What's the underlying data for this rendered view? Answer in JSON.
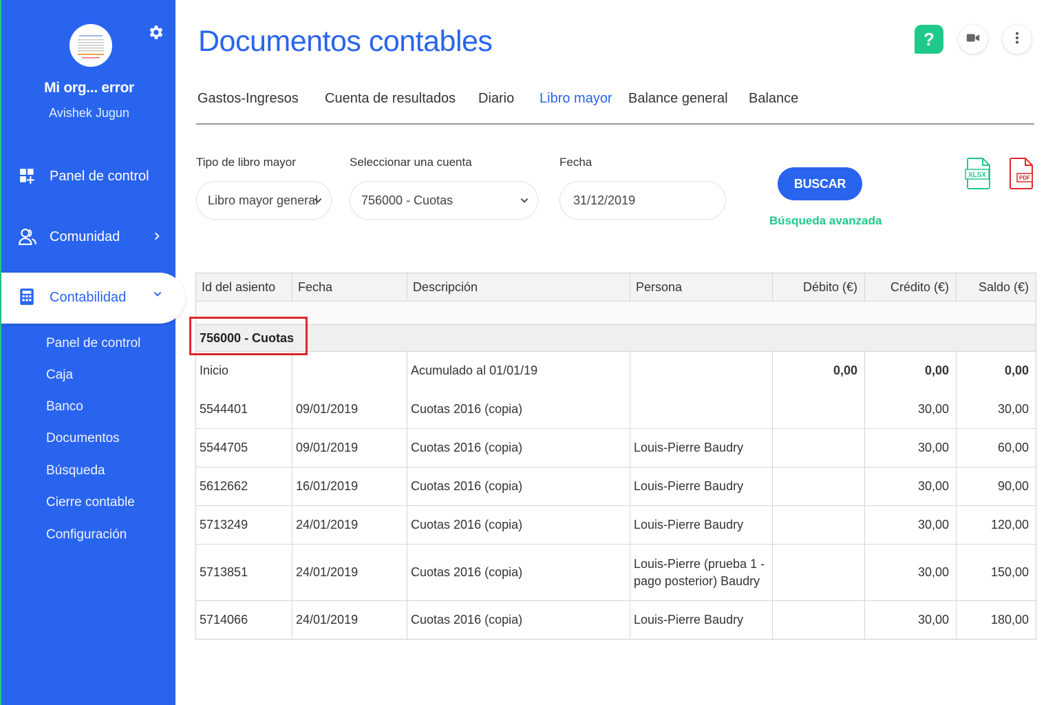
{
  "sidebar": {
    "org_name": "Mi org... error",
    "user_name": "Avishek Jugun",
    "nav": [
      {
        "label": "Panel de control",
        "icon": "dashboard-icon"
      },
      {
        "label": "Comunidad",
        "icon": "community-icon"
      }
    ],
    "active": {
      "label": "Contabilidad",
      "icon": "calculator-icon"
    },
    "sub_items": [
      "Panel de control",
      "Caja",
      "Banco",
      "Documentos",
      "Búsqueda",
      "Cierre contable",
      "Configuración"
    ]
  },
  "header": {
    "title": "Documentos contables",
    "help_label": "?"
  },
  "tabs": [
    "Gastos-Ingresos",
    "Cuenta de resultados",
    "Diario",
    "Libro mayor",
    "Balance general",
    "Balance"
  ],
  "active_tab": "Libro mayor",
  "filters": {
    "tipo_label": "Tipo de libro mayor",
    "tipo_value": "Libro mayor general",
    "cuenta_label": "Seleccionar una cuenta",
    "cuenta_value": "756000 - Cuotas",
    "fecha_label": "Fecha",
    "fecha_value": "31/12/2019",
    "search_button": "BUSCAR",
    "advanced_link": "Búsqueda avanzada",
    "xlsx_label": "XLSX",
    "pdf_label": "PDF"
  },
  "table": {
    "headers": [
      "Id del asiento",
      "Fecha",
      "Descripción",
      "Persona",
      "Débito (€)",
      "Crédito (€)",
      "Saldo (€)"
    ],
    "group": "756000 - Cuotas",
    "opening": {
      "id": "Inicio",
      "fecha": "",
      "desc": "Acumulado al 01/01/19",
      "persona": "",
      "debito": "0,00",
      "credito": "0,00",
      "saldo": "0,00"
    },
    "rows": [
      {
        "id": "5544401",
        "fecha": "09/01/2019",
        "desc": "Cuotas 2016 (copia)",
        "persona": "",
        "debito": "",
        "credito": "30,00",
        "saldo": "30,00"
      },
      {
        "id": "5544705",
        "fecha": "09/01/2019",
        "desc": "Cuotas 2016 (copia)",
        "persona": "Louis-Pierre Baudry",
        "debito": "",
        "credito": "30,00",
        "saldo": "60,00"
      },
      {
        "id": "5612662",
        "fecha": "16/01/2019",
        "desc": "Cuotas 2016 (copia)",
        "persona": "Louis-Pierre Baudry",
        "debito": "",
        "credito": "30,00",
        "saldo": "90,00"
      },
      {
        "id": "5713249",
        "fecha": "24/01/2019",
        "desc": "Cuotas 2016 (copia)",
        "persona": "Louis-Pierre Baudry",
        "debito": "",
        "credito": "30,00",
        "saldo": "120,00"
      },
      {
        "id": "5713851",
        "fecha": "24/01/2019",
        "desc": "Cuotas 2016 (copia)",
        "persona": "Louis-Pierre (prueba 1 - pago posterior) Baudry",
        "debito": "",
        "credito": "30,00",
        "saldo": "150,00"
      },
      {
        "id": "5714066",
        "fecha": "24/01/2019",
        "desc": "Cuotas 2016 (copia)",
        "persona": "Louis-Pierre Baudry",
        "debito": "",
        "credito": "30,00",
        "saldo": "180,00"
      }
    ]
  },
  "colors": {
    "brand_blue": "#2864ee",
    "accent_green": "#1fc98a",
    "highlight_red": "#e0262b"
  }
}
